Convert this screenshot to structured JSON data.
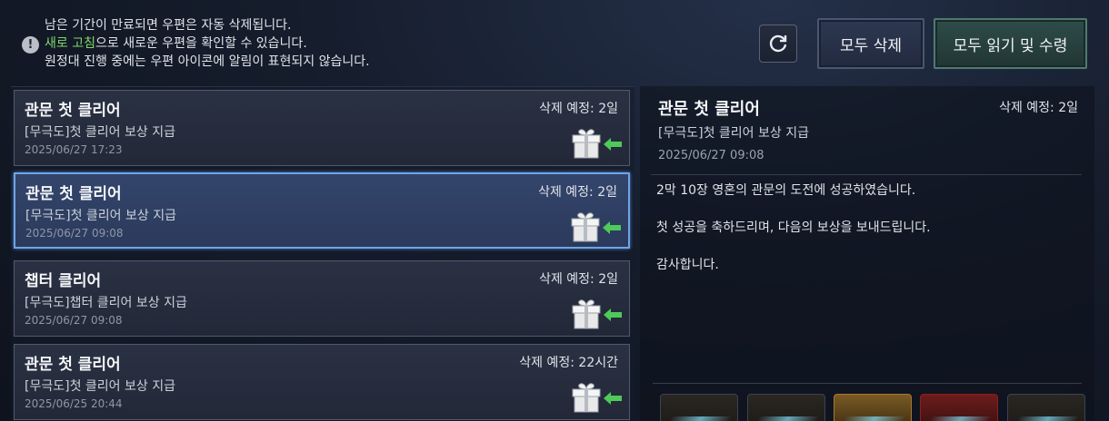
{
  "notice": {
    "line1": "남은 기간이 만료되면 우편은 자동 삭제됩니다.",
    "line2_highlight": "새로 고침",
    "line2_rest": "으로 새로운 우편을 확인할 수 있습니다.",
    "line3": "원정대 진행 중에는 우편 아이콘에 알림이 표현되지 않습니다.",
    "icon": "exclamation-icon"
  },
  "toolbar": {
    "refresh_icon": "refresh-icon",
    "delete_all_label": "모두 삭제",
    "read_receive_all_label": "모두 읽기 및 수령"
  },
  "mails": [
    {
      "title": "관문 첫 클리어",
      "subtitle": "[무극도]첫 클리어 보상 지급",
      "date": "2025/06/27 17:23",
      "expiry": "삭제 예정: 2일",
      "selected": false
    },
    {
      "title": "관문 첫 클리어",
      "subtitle": "[무극도]첫 클리어 보상 지급",
      "date": "2025/06/27 09:08",
      "expiry": "삭제 예정: 2일",
      "selected": true
    },
    {
      "title": "챕터 클리어",
      "subtitle": "[무극도]챕터 클리어 보상 지급",
      "date": "2025/06/27 09:08",
      "expiry": "삭제 예정: 2일",
      "selected": false
    },
    {
      "title": "관문 첫 클리어",
      "subtitle": "[무극도]첫 클리어 보상 지급",
      "date": "2025/06/25 20:44",
      "expiry": "삭제 예정: 22시간",
      "selected": false
    }
  ],
  "detail": {
    "title": "관문 첫 클리어",
    "expiry": "삭제 예정: 2일",
    "subtitle": "[무극도]첫 클리어 보상 지급",
    "date": "2025/06/27 09:08",
    "body": [
      "2막 10장 영혼의 관문의 도전에 성공하였습니다.",
      "첫 성공을 축하드리며, 다음의 보상을 보내드립니다.",
      "감사합니다."
    ],
    "rewards": [
      "reward-item-icon",
      "reward-item-icon",
      "reward-item-icon",
      "reward-item-icon",
      "reward-item-icon"
    ]
  },
  "colors": {
    "highlight": "#7fd86a",
    "selected_border": "#6fa4e6",
    "arrow_green": "#4ec95a",
    "reward_gold": "#a8792c",
    "reward_red": "#8a1f1f"
  }
}
